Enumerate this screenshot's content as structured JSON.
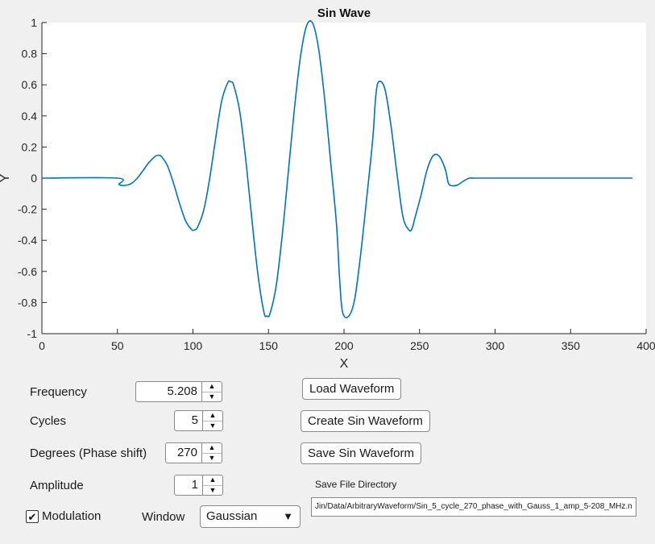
{
  "chart_data": {
    "type": "line",
    "title": "Sin Wave",
    "xlabel": "X",
    "ylabel": "Y",
    "xlim": [
      0,
      400
    ],
    "ylim": [
      -1,
      1
    ],
    "xticks": [
      "0",
      "50",
      "100",
      "150",
      "200",
      "250",
      "300",
      "350",
      "400"
    ],
    "yticks": [
      "1",
      "0.8",
      "0.6",
      "0.4",
      "0.2",
      "0",
      "-0.2",
      "-0.4",
      "-0.6",
      "-0.8",
      "-1"
    ],
    "grid": false,
    "series": [
      {
        "color": "#0072bd",
        "x": [
          0,
          50,
          51,
          53,
          55,
          59,
          63,
          67,
          71,
          75,
          77,
          79,
          83,
          87,
          91,
          95,
          99,
          101,
          103,
          107,
          111,
          115,
          119,
          123,
          125,
          127,
          131,
          135,
          139,
          143,
          147,
          149,
          151,
          155,
          159,
          163,
          167,
          171,
          175,
          179,
          183,
          187,
          191,
          195,
          197,
          199,
          203,
          207,
          211,
          215,
          219,
          221,
          223,
          227,
          231,
          235,
          239,
          243,
          245,
          247,
          251,
          255,
          259,
          263,
          267,
          269,
          271,
          275,
          279,
          283,
          287,
          290,
          291,
          391
        ],
        "y": [
          0,
          0,
          -0.04,
          -0.047,
          -0.047,
          -0.036,
          -0.002,
          0.049,
          0.102,
          0.14,
          0.147,
          0.14,
          0.082,
          -0.029,
          -0.159,
          -0.272,
          -0.33,
          -0.333,
          -0.316,
          -0.211,
          -0.007,
          0.254,
          0.495,
          0.613,
          0.619,
          0.596,
          0.427,
          0.115,
          -0.264,
          -0.619,
          -0.863,
          -0.886,
          -0.871,
          -0.698,
          -0.377,
          0.026,
          0.431,
          0.769,
          0.973,
          1.0,
          0.843,
          0.525,
          0.119,
          -0.294,
          -0.636,
          -0.86,
          -0.889,
          -0.781,
          -0.491,
          -0.13,
          0.249,
          0.526,
          0.62,
          0.575,
          0.343,
          0.033,
          -0.248,
          -0.334,
          -0.325,
          -0.254,
          -0.109,
          0.054,
          0.144,
          0.141,
          0.058,
          -0.03,
          -0.048,
          -0.045,
          -0.02,
          0.0,
          0.0,
          0.0,
          0.0,
          0.0
        ]
      }
    ]
  },
  "controls": {
    "frequency": {
      "label": "Frequency",
      "value": "5.208"
    },
    "cycles": {
      "label": "Cycles",
      "value": "5"
    },
    "degrees": {
      "label": "Degrees  (Phase shift)",
      "value": "270"
    },
    "amplitude": {
      "label": "Amplitude",
      "value": "1"
    },
    "modulation": {
      "label": "Modulation",
      "checked": true
    },
    "window": {
      "label": "Window",
      "selected": "Gaussian"
    }
  },
  "buttons": {
    "load": "Load Waveform",
    "create": "Create Sin Waveform",
    "save": "Save Sin Waveform"
  },
  "save_dir": {
    "label": "Save File Directory",
    "value": "Jin/Data/ArbitraryWaveform/Sin_5_cycle_270_phase_with_Gauss_1_amp_5-208_MHz.n"
  },
  "icons": {
    "spinner_up": "▲",
    "spinner_down": "▼",
    "checkmark": "✔",
    "dropdown_caret": "▼"
  }
}
